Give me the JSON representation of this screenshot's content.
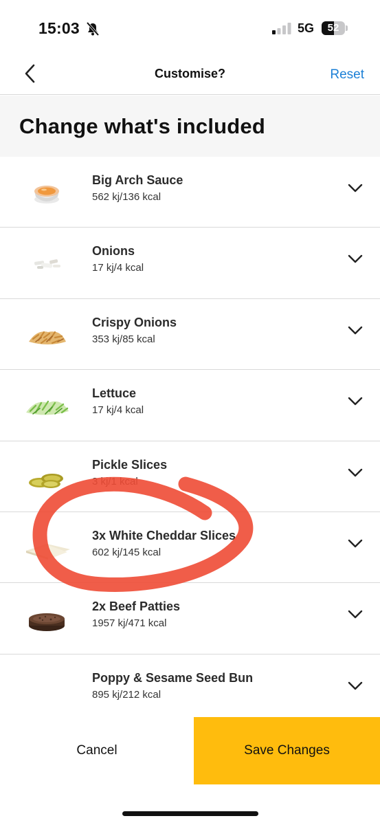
{
  "status_bar": {
    "time": "15:03",
    "network": "5G",
    "battery_level": "52",
    "battery_fraction": 0.52,
    "signal_bars_active": 1
  },
  "nav": {
    "title": "Customise?",
    "reset_label": "Reset",
    "back_icon": "chevron-left-icon"
  },
  "section": {
    "title": "Change what's included"
  },
  "ingredients": [
    {
      "name": "Big Arch Sauce",
      "energy": "562 kj/136 kcal",
      "icon": "sauce-cup-icon"
    },
    {
      "name": "Onions",
      "energy": "17 kj/4 kcal",
      "icon": "onion-pieces-icon"
    },
    {
      "name": "Crispy Onions",
      "energy": "353 kj/85 kcal",
      "icon": "crispy-onions-icon"
    },
    {
      "name": "Lettuce",
      "energy": "17 kj/4 kcal",
      "icon": "lettuce-icon"
    },
    {
      "name": "Pickle Slices",
      "energy": "3 kj/1 kcal",
      "icon": "pickle-slices-icon"
    },
    {
      "name": "3x White Cheddar Slices",
      "energy": "602 kj/145 kcal",
      "icon": "cheese-slices-icon"
    },
    {
      "name": "2x Beef Patties",
      "energy": "1957 kj/471 kcal",
      "icon": "beef-patty-icon"
    },
    {
      "name": "Poppy & Sesame Seed Bun",
      "energy": "895 kj/212 kcal",
      "icon": "bun-icon"
    }
  ],
  "actions": {
    "cancel_label": "Cancel",
    "save_label": "Save Changes"
  },
  "colors": {
    "accent_yellow": "#ffbc0d",
    "link_blue": "#1b7fd6",
    "annotation_red": "#ee4b35",
    "section_bg": "#f6f6f6"
  }
}
